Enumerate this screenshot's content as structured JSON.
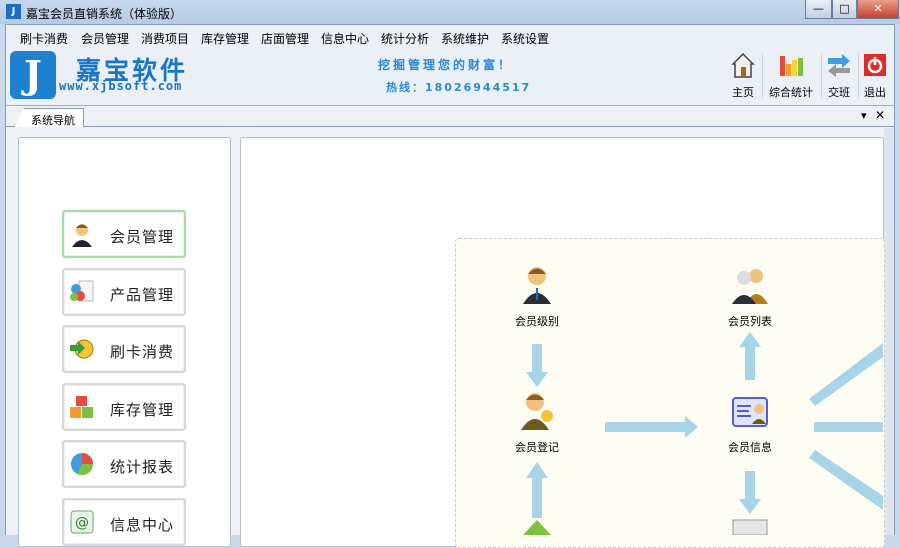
{
  "window": {
    "title": "嘉宝会员直销系统（体验版）",
    "minimize": "—",
    "maximize": "□",
    "close": "✕"
  },
  "menu": [
    "刷卡消费",
    "会员管理",
    "消费项目",
    "库存管理",
    "店面管理",
    "信息中心",
    "统计分析",
    "系统维护",
    "系统设置"
  ],
  "banner": {
    "logo_letter": "J",
    "brand": "嘉宝软件",
    "url": "www.xjbsoft.com",
    "slogan": "挖掘管理您的财富！",
    "hotline": "热线：18026944517"
  },
  "toolbar": [
    {
      "label": "主页",
      "icon": "home-icon"
    },
    {
      "label": "综合统计",
      "icon": "chart-icon"
    },
    {
      "label": "交班",
      "icon": "swap-icon"
    },
    {
      "label": "退出",
      "icon": "power-icon"
    }
  ],
  "tab": {
    "label": "系统导航",
    "dropdown": "▾",
    "close": "✕"
  },
  "nav": [
    {
      "label": "会员管理",
      "active": true
    },
    {
      "label": "产品管理"
    },
    {
      "label": "刷卡消费"
    },
    {
      "label": "库存管理"
    },
    {
      "label": "统计报表"
    },
    {
      "label": "信息中心"
    }
  ],
  "diagram": {
    "nodes": [
      "会员级别",
      "会员列表",
      "会员登记",
      "会员信息"
    ]
  },
  "colors": {
    "accent": "#1a75c7",
    "arrow": "#a8d4e8",
    "diagram_bg": "#fdfdf3"
  }
}
